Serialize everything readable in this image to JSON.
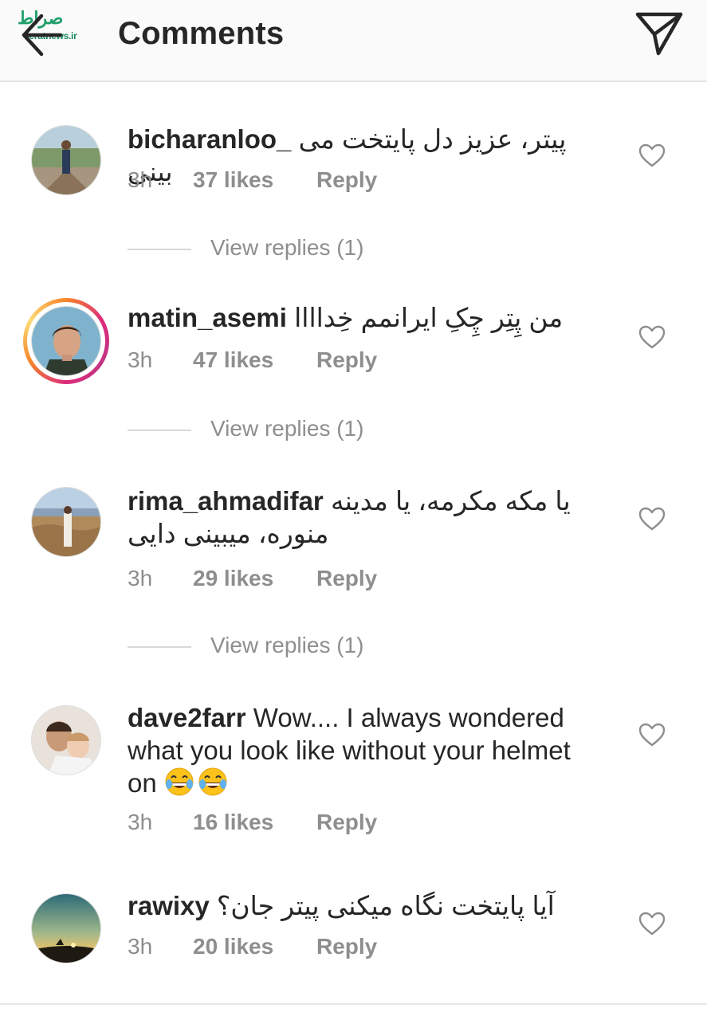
{
  "header": {
    "title": "Comments",
    "back_icon": "arrow-left-icon",
    "send_icon": "paper-plane-icon",
    "watermark": {
      "logo_text": "صراط",
      "url_text": "seratnews.ir"
    }
  },
  "comments": [
    {
      "username": "bicharanloo_",
      "text": "پیتر، عزیز دل پایتخت می بینی",
      "time": "3h",
      "likes": "37 likes",
      "reply": "Reply",
      "view_replies": "View replies (1)",
      "has_story": false
    },
    {
      "username": "matin_asemi",
      "text": "من پِتِر چِکِ ایرانمم خِداااا",
      "time": "3h",
      "likes": "47 likes",
      "reply": "Reply",
      "view_replies": "View replies (1)",
      "has_story": true
    },
    {
      "username": "rima_ahmadifar",
      "text": "یا مکه مکرمه، یا مدینه منوره، میبینی دایی",
      "time": "3h",
      "likes": "29 likes",
      "reply": "Reply",
      "view_replies": "View replies (1)",
      "has_story": false
    },
    {
      "username": "dave2farr",
      "text": "Wow.... I always wondered what you look like without your helmet on",
      "emoji": "face-with-tears-of-joy",
      "time": "3h",
      "likes": "16 likes",
      "reply": "Reply",
      "has_story": false
    },
    {
      "username": "rawixy",
      "text": "آیا پایتخت نگاه میکنی پیتر جان؟",
      "time": "3h",
      "likes": "20 likes",
      "reply": "Reply",
      "has_story": false
    }
  ],
  "colors": {
    "text": "#262626",
    "meta": "#8e8e8e",
    "header_bg": "#fafafa",
    "story_ring": "#dd2a7b"
  }
}
